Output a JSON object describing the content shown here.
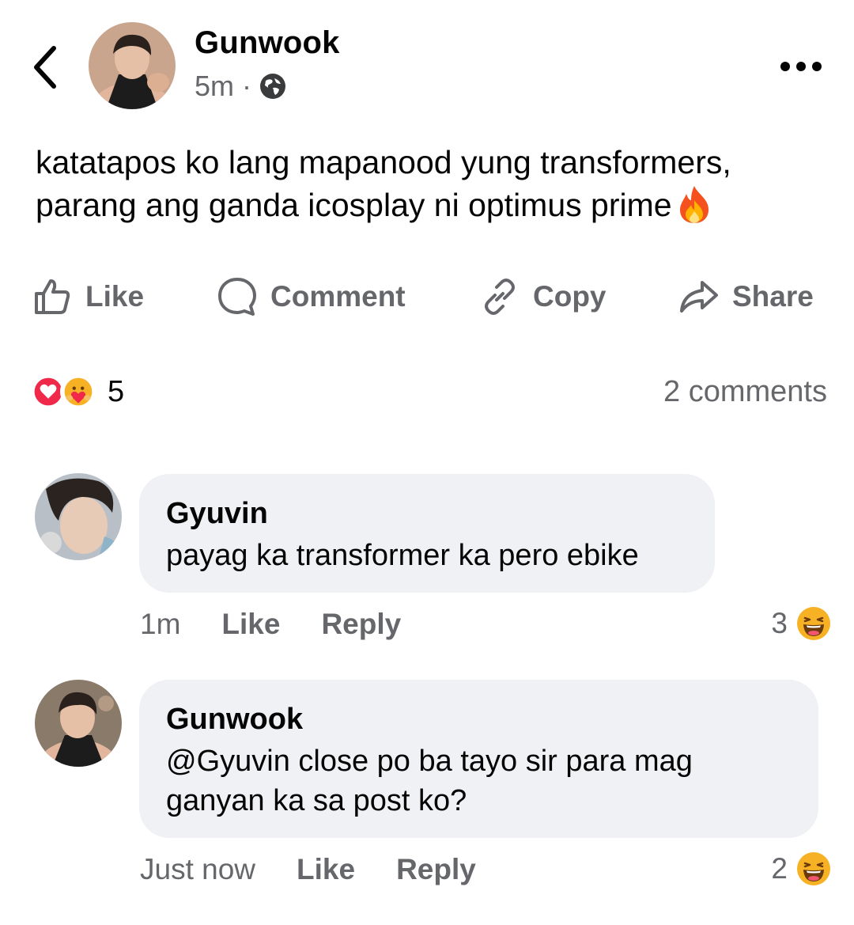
{
  "post": {
    "author": "Gunwook",
    "time": "5m",
    "separator": "·",
    "audience_icon": "globe-icon",
    "text": "katatapos ko lang mapanood yung transformers, parang ang ganda icosplay ni optimus prime",
    "emoji": "fire-emoji"
  },
  "actions": {
    "like": "Like",
    "comment": "Comment",
    "copy": "Copy",
    "share": "Share"
  },
  "reactions": {
    "icons": [
      "love-reaction-icon",
      "care-reaction-icon"
    ],
    "count": "5",
    "comments_count": "2 comments"
  },
  "comments": [
    {
      "author": "Gyuvin",
      "text": "payag ka transformer ka pero ebike",
      "time": "1m",
      "like": "Like",
      "reply": "Reply",
      "reaction_count": "3",
      "reaction_icon": "haha-reaction-icon"
    },
    {
      "author": "Gunwook",
      "text": "@Gyuvin close po ba tayo sir para mag ganyan ka sa post ko?",
      "time": "Just now",
      "like": "Like",
      "reply": "Reply",
      "reaction_count": "2",
      "reaction_icon": "haha-reaction-icon"
    }
  ],
  "colors": {
    "text": "#050505",
    "secondary": "#65676b",
    "bubble": "#f0f1f4",
    "love": "#f02849",
    "haha": "#f7b125"
  }
}
